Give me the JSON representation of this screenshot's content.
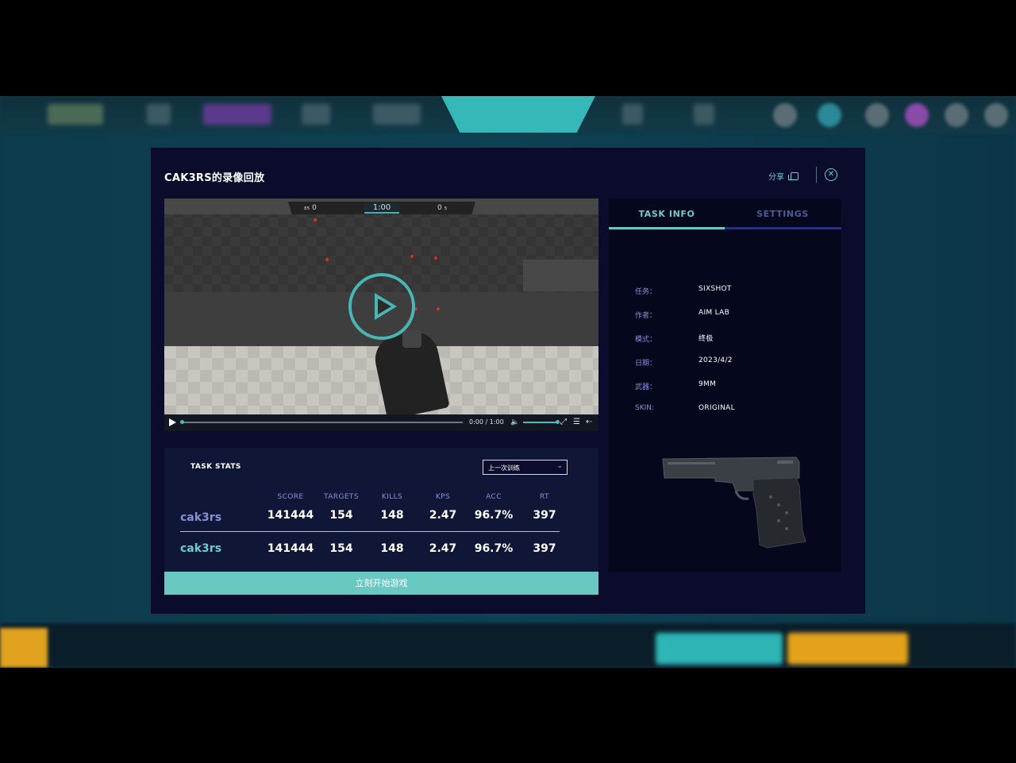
{
  "dialog": {
    "title": "CAK3RS的录像回放",
    "share_label": "分享",
    "close_symbol": "✕"
  },
  "video": {
    "hud_time": "1:00",
    "hud_left": "₈₅ 0",
    "hud_right": "0 ₅",
    "time_display": "0:00 / 1:00"
  },
  "stats": {
    "title": "TASK STATS",
    "select_value": "上一次训练",
    "headers": [
      "SCORE",
      "TARGETS",
      "KILLS",
      "KPS",
      "ACC",
      "RT"
    ],
    "rows": [
      {
        "name": "cak3rs",
        "name_color": "#8b8fd7",
        "values": [
          "141444",
          "154",
          "148",
          "2.47",
          "96.7%",
          "397"
        ]
      },
      {
        "name": "cak3rs",
        "name_color": "#6ecdcc",
        "values": [
          "141444",
          "154",
          "148",
          "2.47",
          "96.7%",
          "397"
        ]
      }
    ],
    "start_label": "立刻开始游戏"
  },
  "panel": {
    "tabs": [
      "TASK INFO",
      "SETTINGS"
    ],
    "info": [
      {
        "label": "任务：",
        "value": "SIXSHOT"
      },
      {
        "label": "作者：",
        "value": "AIM LAB"
      },
      {
        "label": "模式：",
        "value": "终极"
      },
      {
        "label": "日期：",
        "value": "2023/4/2"
      },
      {
        "label": "武器：",
        "value": "9MM"
      },
      {
        "label": "SKIN:",
        "value": "ORIGINAL"
      }
    ]
  },
  "colors": {
    "accent": "#6ac8c3",
    "modal_bg": "#0b0c2b",
    "label": "#8b8fd7"
  },
  "icons": [
    "play-icon",
    "volume-icon",
    "fullscreen-icon",
    "settings-icon",
    "share-icon",
    "close-icon"
  ]
}
